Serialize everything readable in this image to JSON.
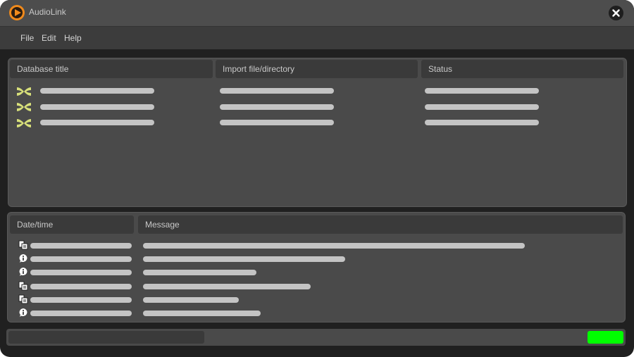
{
  "app": {
    "title": "AudioLink",
    "logo_icon": "play-icon",
    "accent_color": "#f08a1c"
  },
  "menu": {
    "items": [
      "File",
      "Edit",
      "Help"
    ]
  },
  "database_table": {
    "columns": [
      "Database title",
      "Import file/directory",
      "Status"
    ],
    "rows": 3,
    "row_icon": "database-link-icon",
    "icon_color": "#d8e07a"
  },
  "log_table": {
    "columns": [
      "Date/time",
      "Message"
    ],
    "row_icons": [
      "document-icon",
      "info-icon",
      "info-icon",
      "document-icon",
      "document-icon",
      "info-icon"
    ]
  },
  "status": {
    "indicator_color": "#00ff00"
  }
}
